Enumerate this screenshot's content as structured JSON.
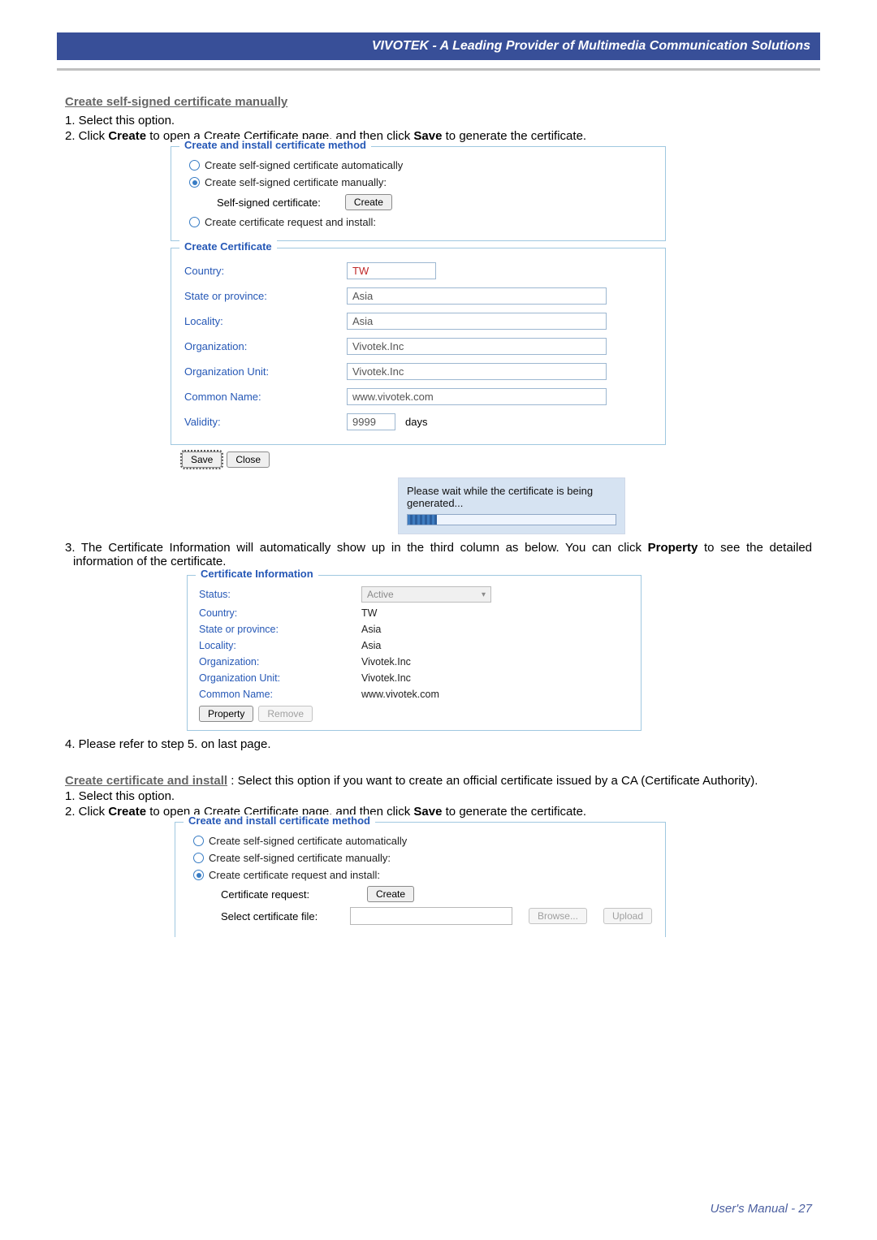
{
  "header": {
    "banner": "VIVOTEK - A Leading Provider of Multimedia Communication Solutions"
  },
  "section1": {
    "title": "Create self-signed certificate manually",
    "step1": "1. Select this option.",
    "step2_pre": "2. Click ",
    "step2_b1": "Create",
    "step2_mid": " to open a Create Certificate page, and then click ",
    "step2_b2": "Save",
    "step2_post": " to generate the certificate."
  },
  "ss1_method": {
    "legend": "Create and install certificate method",
    "opt1": "Create self-signed certificate automatically",
    "opt2": "Create self-signed certificate manually:",
    "selfsigned_label": "Self-signed certificate:",
    "create_btn": "Create",
    "opt3": "Create certificate request and install:"
  },
  "ss1_cert": {
    "legend": "Create Certificate",
    "rows": {
      "country_l": "Country:",
      "country_v": "TW",
      "state_l": "State or province:",
      "state_v": "Asia",
      "locality_l": "Locality:",
      "locality_v": "Asia",
      "org_l": "Organization:",
      "org_v": "Vivotek.Inc",
      "orgunit_l": "Organization Unit:",
      "orgunit_v": "Vivotek.Inc",
      "cn_l": "Common Name:",
      "cn_v": "www.vivotek.com",
      "validity_l": "Validity:",
      "validity_v": "9999",
      "validity_unit": "days"
    },
    "save_btn": "Save",
    "close_btn": "Close",
    "wait_msg": "Please wait while the certificate is being generated..."
  },
  "section3": {
    "text_pre": "3. The Certificate Information will automatically show up in the third column as below. You can click ",
    "bold": "Property",
    "text_post": " to see the detailed information of the certificate."
  },
  "ss2_info": {
    "legend": "Certificate Information",
    "rows": {
      "status_l": "Status:",
      "status_v": "Active",
      "country_l": "Country:",
      "country_v": "TW",
      "state_l": "State or province:",
      "state_v": "Asia",
      "locality_l": "Locality:",
      "locality_v": "Asia",
      "org_l": "Organization:",
      "org_v": "Vivotek.Inc",
      "orgunit_l": "Organization Unit:",
      "orgunit_v": "Vivotek.Inc",
      "cn_l": "Common Name:",
      "cn_v": "www.vivotek.com"
    },
    "property_btn": "Property",
    "remove_btn": "Remove"
  },
  "step4": "4. Please refer to step 5. on last page.",
  "section5": {
    "title": "Create certificate and install",
    "tail": " :  Select this option if you want to create an official certificate issued by a CA (Certificate Authority).",
    "s1": "1. Select this option.",
    "s2_pre": "2. Click ",
    "s2_b1": "Create",
    "s2_mid": " to open a Create Certificate page, and then click ",
    "s2_b2": "Save",
    "s2_post": " to generate the certificate."
  },
  "ss3": {
    "legend": "Create and install certificate method",
    "opt1": "Create self-signed certificate automatically",
    "opt2": "Create self-signed certificate manually:",
    "opt3": "Create certificate request and install:",
    "req_label": "Certificate request:",
    "create_btn": "Create",
    "file_label": "Select certificate file:",
    "browse_btn": "Browse...",
    "upload_btn": "Upload"
  },
  "footer": "User's Manual - 27"
}
